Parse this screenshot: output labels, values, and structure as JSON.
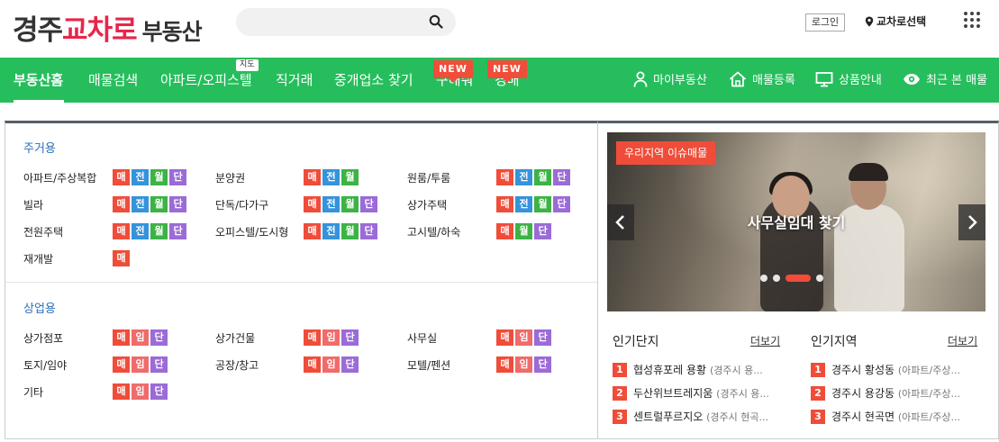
{
  "header": {
    "logo": {
      "part1": "경주",
      "part2": "교차로",
      "part3": "부동산"
    },
    "search": {
      "placeholder": ""
    },
    "login_label": "로그인",
    "region_label": "교차로선택"
  },
  "nav": {
    "items": [
      {
        "label": "부동산홈"
      },
      {
        "label": "매물검색"
      },
      {
        "label": "아파트/오피스텔",
        "badge": "지도"
      },
      {
        "label": "직거래"
      },
      {
        "label": "중개업소 찾기"
      },
      {
        "label": "구해줘",
        "badge": "NEW"
      },
      {
        "label": "경매",
        "badge": "NEW"
      }
    ],
    "right": [
      {
        "label": "마이부동산",
        "icon": "person-icon"
      },
      {
        "label": "매물등록",
        "icon": "house-icon"
      },
      {
        "label": "상품안내",
        "icon": "monitor-icon"
      },
      {
        "label": "최근 본 매물",
        "icon": "eye-icon"
      }
    ]
  },
  "residential": {
    "title": "주거용",
    "items": [
      {
        "name": "아파트/주상복합",
        "tags": [
          "매",
          "전",
          "월",
          "단"
        ]
      },
      {
        "name": "분양권",
        "tags": [
          "매",
          "전",
          "월"
        ]
      },
      {
        "name": "원룸/투룸",
        "tags": [
          "매",
          "전",
          "월",
          "단"
        ]
      },
      {
        "name": "빌라",
        "tags": [
          "매",
          "전",
          "월",
          "단"
        ]
      },
      {
        "name": "단독/다가구",
        "tags": [
          "매",
          "전",
          "월",
          "단"
        ]
      },
      {
        "name": "상가주택",
        "tags": [
          "매",
          "전",
          "월",
          "단"
        ]
      },
      {
        "name": "전원주택",
        "tags": [
          "매",
          "전",
          "월",
          "단"
        ]
      },
      {
        "name": "오피스텔/도시형",
        "tags": [
          "매",
          "전",
          "월",
          "단"
        ]
      },
      {
        "name": "고시텔/하숙",
        "tags": [
          "매",
          "월",
          "단"
        ]
      },
      {
        "name": "재개발",
        "tags": [
          "매"
        ]
      }
    ]
  },
  "commercial": {
    "title": "상업용",
    "items": [
      {
        "name": "상가점포",
        "tags": [
          "매",
          "임",
          "단"
        ]
      },
      {
        "name": "상가건물",
        "tags": [
          "매",
          "임",
          "단"
        ]
      },
      {
        "name": "사무실",
        "tags": [
          "매",
          "임",
          "단"
        ]
      },
      {
        "name": "토지/임야",
        "tags": [
          "매",
          "임",
          "단"
        ]
      },
      {
        "name": "공장/창고",
        "tags": [
          "매",
          "임",
          "단"
        ]
      },
      {
        "name": "모텔/펜션",
        "tags": [
          "매",
          "임",
          "단"
        ]
      },
      {
        "name": "기타",
        "tags": [
          "매",
          "임",
          "단"
        ]
      }
    ]
  },
  "banner": {
    "tag": "우리지역 이슈매물",
    "title": "사무실임대 찾기",
    "slide_count": 4,
    "active_slide": 3
  },
  "popular_complex": {
    "title": "인기단지",
    "more": "더보기",
    "items": [
      {
        "rank": "1",
        "name": "협성휴포레 용황",
        "sub": "(경주시 용..."
      },
      {
        "rank": "2",
        "name": "두산위브트레지움",
        "sub": "(경주시 용..."
      },
      {
        "rank": "3",
        "name": "센트럴푸르지오",
        "sub": "(경주시 현곡..."
      }
    ]
  },
  "popular_region": {
    "title": "인기지역",
    "more": "더보기",
    "items": [
      {
        "rank": "1",
        "name": "경주시 황성동",
        "sub": "(아파트/주상..."
      },
      {
        "rank": "2",
        "name": "경주시 용강동",
        "sub": "(아파트/주상..."
      },
      {
        "rank": "3",
        "name": "경주시 현곡면",
        "sub": "(아파트/주상..."
      }
    ]
  },
  "colors": {
    "brand_green": "#26be5c",
    "accent_red": "#ef4d3a",
    "logo_pink": "#e8254a",
    "tag_mae": "#ef4d3a",
    "tag_jeon": "#3593db",
    "tag_wol": "#3db345",
    "tag_dan": "#9b6bd6",
    "tag_im": "#f06b6b"
  }
}
